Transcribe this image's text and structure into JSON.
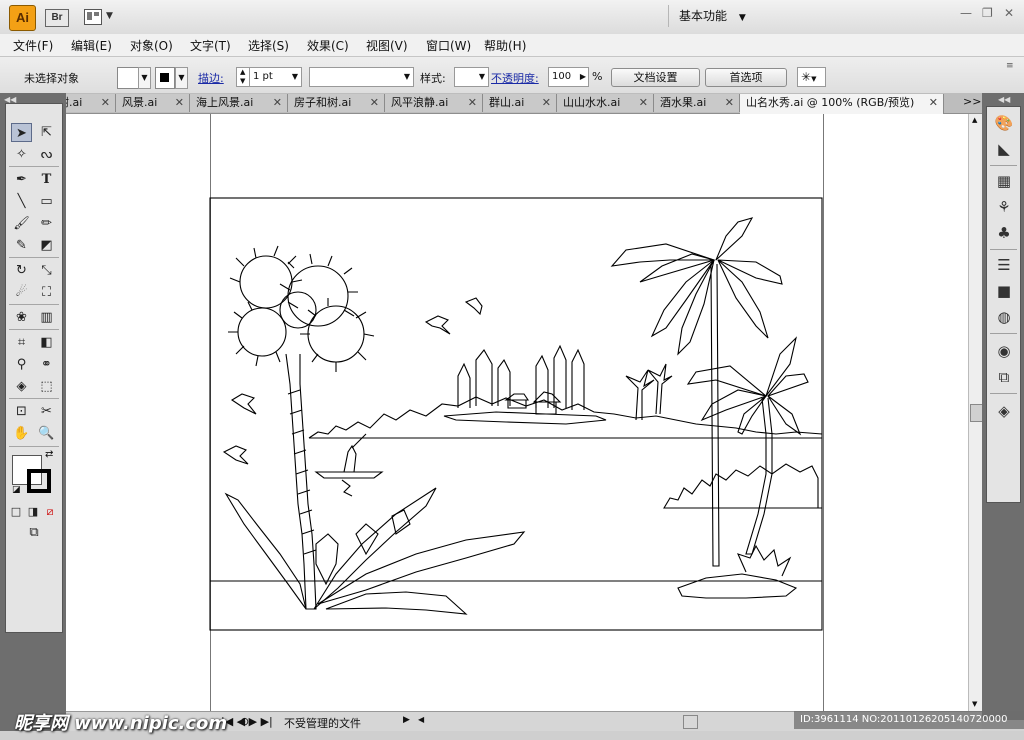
{
  "title_bar": {
    "app_logo": "Ai",
    "bridge_button": "Br",
    "workspace": "基本功能"
  },
  "menu": [
    "文件(F)",
    "编辑(E)",
    "对象(O)",
    "文字(T)",
    "选择(S)",
    "效果(C)",
    "视图(V)",
    "窗口(W)",
    "帮助(H)"
  ],
  "control_bar": {
    "selection_status": "未选择对象",
    "stroke_label": "描边:",
    "stroke_weight": "1 pt",
    "style_label": "样式:",
    "opacity_label": "不透明度:",
    "opacity_value": "100",
    "opacity_unit": "%",
    "doc_setup_button": "文档设置",
    "preferences_button": "首选项"
  },
  "tabs": [
    {
      "label": "树.ai",
      "active": false
    },
    {
      "label": "风景.ai",
      "active": false
    },
    {
      "label": "海上风景.ai",
      "active": false
    },
    {
      "label": "房子和树.ai",
      "active": false
    },
    {
      "label": "风平浪静.ai",
      "active": false
    },
    {
      "label": "群山.ai",
      "active": false
    },
    {
      "label": "山山水水.ai",
      "active": false
    },
    {
      "label": "酒水果.ai",
      "active": false
    },
    {
      "label": "山名水秀.ai @ 100% (RGB/预览)",
      "active": true
    }
  ],
  "tab_overflow": ">>",
  "status_bar": {
    "document_status": "不受管理的文件"
  },
  "watermark": "昵享网 www.nipic.com",
  "image_id": "ID:3961114 NO:20110126205140720000",
  "icons": {
    "tools": [
      "selection-tool",
      "direct-selection-tool",
      "magic-wand-tool",
      "lasso-tool",
      "pen-tool",
      "type-tool",
      "line-tool",
      "rectangle-tool",
      "paintbrush-tool",
      "pencil-tool",
      "blob-brush-tool",
      "eraser-tool",
      "rotate-tool",
      "scale-tool",
      "warp-tool",
      "free-transform-tool",
      "symbol-sprayer-tool",
      "column-graph-tool",
      "mesh-tool",
      "gradient-tool",
      "eyedropper-tool",
      "blend-tool",
      "live-paint-bucket-tool",
      "live-paint-selection-tool",
      "artboard-tool",
      "slice-tool",
      "hand-tool",
      "zoom-tool"
    ],
    "right_panels": [
      "color-icon",
      "color-guide-icon",
      "swatches-icon",
      "brushes-icon",
      "symbols-icon",
      "stroke-icon",
      "gradient-icon",
      "transparency-icon",
      "appearance-icon",
      "graphic-styles-icon",
      "layers-icon"
    ]
  }
}
